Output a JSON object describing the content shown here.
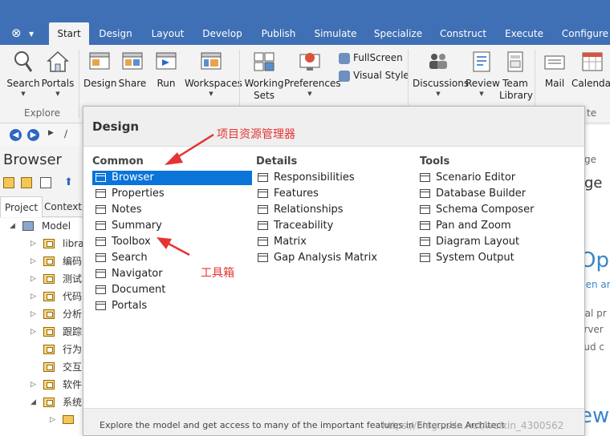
{
  "tabs": [
    "Start",
    "Design",
    "Layout",
    "Develop",
    "Publish",
    "Simulate",
    "Specialize",
    "Construct",
    "Execute",
    "Configure"
  ],
  "active_tab": "Start",
  "ribbon": {
    "search": "Search",
    "portals": "Portals",
    "explore_group": "Explore",
    "design": "Design",
    "share": "Share",
    "run": "Run",
    "workspaces": "Workspaces",
    "working_sets_1": "Working",
    "working_sets_2": "Sets",
    "preferences": "Preferences",
    "fullscreen": "FullScreen",
    "visual_style": "Visual Style",
    "discussions": "Discussions",
    "review": "Review",
    "team_library_1": "Team",
    "team_library_2": "Library",
    "mail": "Mail",
    "calendar": "Calendar",
    "partial_group_label": "te"
  },
  "nav": {
    "path_sep": "/"
  },
  "browser": {
    "title": "Browser",
    "tabs": [
      "Project",
      "Context"
    ],
    "active_tab": "Project",
    "tree": [
      {
        "label": "Model"
      },
      {
        "label": "libra"
      },
      {
        "label": "编码"
      },
      {
        "label": "测试"
      },
      {
        "label": "代码"
      },
      {
        "label": "分析"
      },
      {
        "label": "跟踪"
      },
      {
        "label": "行为"
      },
      {
        "label": "交互"
      },
      {
        "label": "软件"
      },
      {
        "label": "系统"
      }
    ]
  },
  "right_bg": {
    "ge_tab": "ge",
    "ge_big": "ge",
    "ope": "Ope",
    "pen_ar": "pen ar",
    "cal_pr": "cal pr",
    "erver": "erver",
    "oud_c": "oud c",
    "ew": "ew"
  },
  "popup": {
    "title": "Design",
    "columns": [
      {
        "heading": "Common",
        "items": [
          "Browser",
          "Properties",
          "Notes",
          "Summary",
          "Toolbox",
          "Search",
          "Navigator",
          "Document",
          "Portals"
        ]
      },
      {
        "heading": "Details",
        "items": [
          "Responsibilities",
          "Features",
          "Relationships",
          "Traceability",
          "Matrix",
          "Gap Analysis Matrix"
        ]
      },
      {
        "heading": "Tools",
        "items": [
          "Scenario Editor",
          "Database Builder",
          "Schema Composer",
          "Pan and Zoom",
          "Diagram Layout",
          "System Output"
        ]
      }
    ],
    "selected_item": "Browser",
    "footer": "Explore the model and get access to many of the important features in Enterprise Architect",
    "watermark": "https://blog.csdn.net/weixin_4300562"
  },
  "annotations": {
    "browser_note": "项目资源管理器",
    "toolbox_note": "工具箱"
  },
  "colors": {
    "tabbar": "#3f6fb5",
    "selected": "#0a74d9",
    "annotation": "#e53434"
  }
}
